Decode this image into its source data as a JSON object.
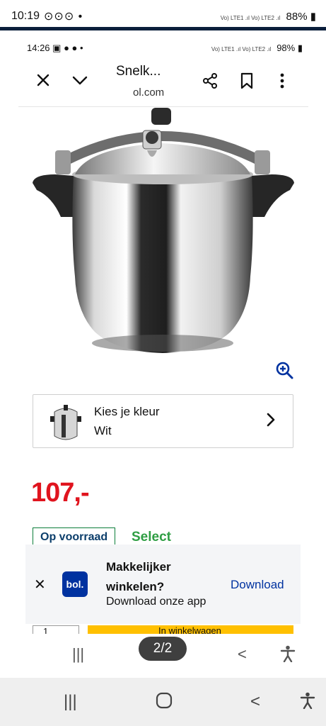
{
  "outer_status": {
    "time": "10:19",
    "battery": "88%",
    "notif_icons": "⊙⊙⊙ •",
    "network": "Vo) LTE1 .ıl Vo) LTE2 .ıl"
  },
  "inner_status": {
    "time": "14:26",
    "battery": "98%",
    "notif_icons": "▣ ● ● •",
    "network": "Vo) LTE1 .ıl Vo) LTE2 .ıl"
  },
  "toolbar": {
    "title": "Snelk...",
    "url": "ol.com",
    "icons": [
      "close-icon",
      "chevron-down-icon",
      "share-icon",
      "bookmark-icon",
      "more-vert-icon"
    ]
  },
  "color_picker": {
    "label": "Kies je kleur",
    "value": "Wit"
  },
  "price": "107,-",
  "stock": {
    "label": "Op voorraad",
    "badge": "Select"
  },
  "banner": {
    "title": "Makkelijker winkelen?",
    "subtitle": "Download onze app",
    "action": "Download",
    "logo": "bol."
  },
  "purchase_peek": {
    "qty": "1",
    "cart": "In winkelwagen"
  },
  "page_indicator": "2/2",
  "colors": {
    "price": "#e0141e",
    "brand": "#0032a0",
    "select": "#2f9e44",
    "cart": "#ffc000"
  }
}
